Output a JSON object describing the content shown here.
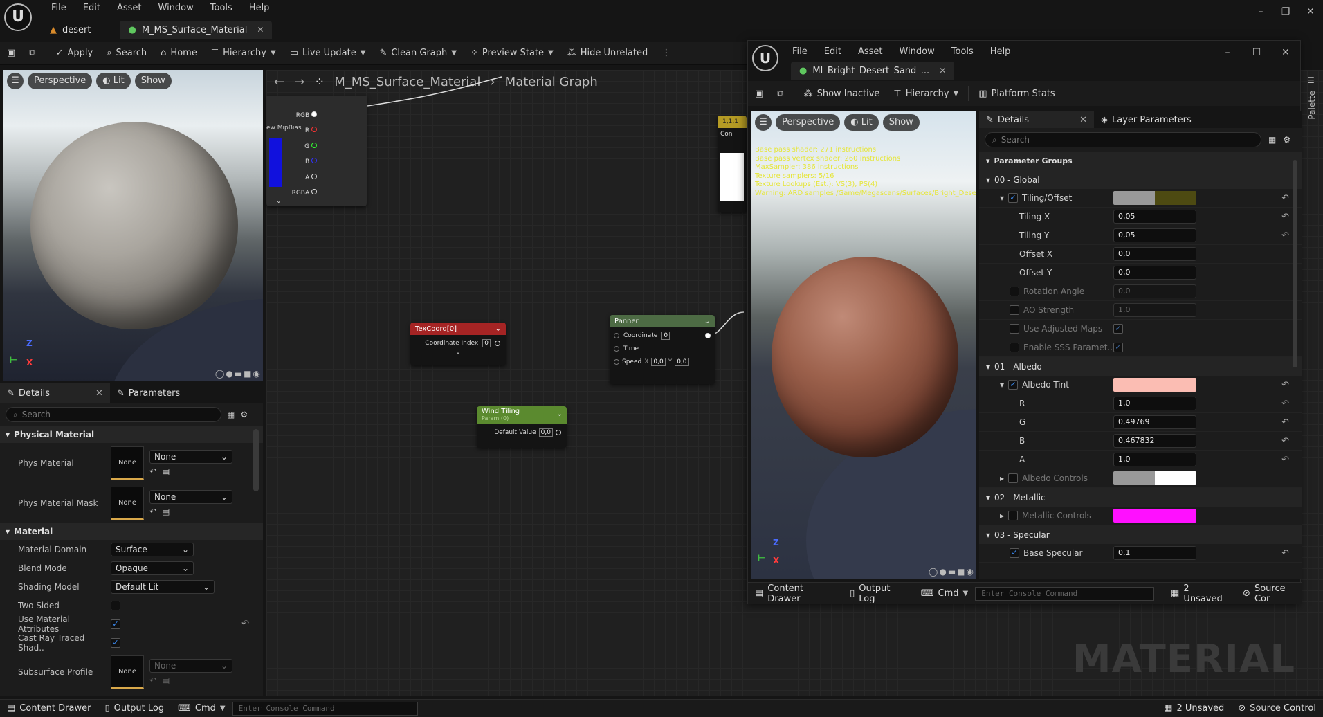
{
  "menu": [
    "File",
    "Edit",
    "Asset",
    "Window",
    "Tools",
    "Help"
  ],
  "doc_tabs": [
    {
      "label": "desert"
    },
    {
      "label": "M_MS_Surface_Material"
    }
  ],
  "toolbar": {
    "apply": "Apply",
    "search": "Search",
    "home": "Home",
    "hierarchy": "Hierarchy",
    "live_update": "Live Update",
    "clean_graph": "Clean Graph",
    "preview_state": "Preview State",
    "hide_unrelated": "Hide Unrelated"
  },
  "left_viewport": {
    "perspective": "Perspective",
    "lit": "Lit",
    "show": "Show"
  },
  "left_details": {
    "tab_details": "Details",
    "tab_parameters": "Parameters",
    "search_placeholder": "Search",
    "physical_material": "Physical Material",
    "phys_material": "Phys Material",
    "phys_material_mask": "Phys Material Mask",
    "none": "None",
    "material_section": "Material",
    "props": [
      {
        "label": "Material Domain",
        "value": "Surface"
      },
      {
        "label": "Blend Mode",
        "value": "Opaque"
      },
      {
        "label": "Shading Model",
        "value": "Default Lit"
      }
    ],
    "two_sided": "Two Sided",
    "use_material_attributes": "Use Material Attributes",
    "cast_ray_traced": "Cast Ray Traced Shad..",
    "subsurface_profile": "Subsurface Profile"
  },
  "graph": {
    "breadcrumb_material": "M_MS_Surface_Material",
    "breadcrumb_graph": "Material Graph",
    "tex_pins": [
      "RGB",
      "R",
      "G",
      "B",
      "A",
      "RGBA"
    ],
    "tex_mip": "ew MipBias",
    "texcoord": {
      "title": "TexCoord[0]",
      "label": "Coordinate Index",
      "value": "0"
    },
    "panner": {
      "title": "Panner",
      "coordinate": "Coordinate",
      "coord_val": "0",
      "time": "Time",
      "speed": "Speed",
      "speed_x": "0,0",
      "speed_y": "0,0",
      "x": "X",
      "y": "Y"
    },
    "wind": {
      "title": "Wind Tiling",
      "subtitle": "Param (0)",
      "label": "Default Value",
      "value": "0,0"
    },
    "const_node": "1,1,1",
    "const_sub": "Con",
    "watermark": "MATERIAL"
  },
  "win2": {
    "menu": [
      "File",
      "Edit",
      "Asset",
      "Window",
      "Tools",
      "Help"
    ],
    "tab": "MI_Bright_Desert_Sand_...",
    "show_inactive": "Show Inactive",
    "hierarchy": "Hierarchy",
    "platform_stats": "Platform Stats",
    "vp_perspective": "Perspective",
    "vp_lit": "Lit",
    "vp_show": "Show",
    "stats": [
      "Base pass shader: 271 instructions",
      "Base pass vertex shader: 260 instructions",
      "MaxSampler: 386 instructions",
      "Texture samplers: 5/16",
      "Texture Lookups (Est.): VS(3), PS(4)",
      "Warning: ARD samples /Game/Megascans/Surfaces/Bright_Dese"
    ],
    "details_tab": "Details",
    "layer_tab": "Layer Parameters",
    "search_placeholder": "Search",
    "parameter_groups": "Parameter Groups",
    "g00": "00 - Global",
    "tiling_offset": "Tiling/Offset",
    "tiling_x": "Tiling X",
    "tiling_x_val": "0,05",
    "tiling_y": "Tiling Y",
    "tiling_y_val": "0,05",
    "offset_x": "Offset X",
    "offset_x_val": "0,0",
    "offset_y": "Offset Y",
    "offset_y_val": "0,0",
    "rotation": "Rotation Angle",
    "rotation_val": "0,0",
    "ao": "AO Strength",
    "ao_val": "1,0",
    "use_adjusted": "Use Adjusted Maps",
    "enable_sss": "Enable SSS Paramet...",
    "g01": "01 - Albedo",
    "albedo_tint": "Albedo Tint",
    "r": "R",
    "r_val": "1,0",
    "g": "G",
    "g_val": "0,49769",
    "b": "B",
    "b_val": "0,467832",
    "a": "A",
    "a_val": "1,0",
    "albedo_controls": "Albedo Controls",
    "g02": "02 - Metallic",
    "metallic_controls": "Metallic Controls",
    "g03": "03 - Specular",
    "base_specular": "Base Specular",
    "base_specular_val": "0,1",
    "colors": {
      "albedo_tint": "#fbbdb3",
      "metallic": "#ff10ff",
      "tiling": "#4d4a12"
    }
  },
  "status": {
    "content_drawer": "Content Drawer",
    "output_log": "Output Log",
    "cmd": "Cmd",
    "console_placeholder": "Enter Console Command",
    "unsaved": "2 Unsaved",
    "source_control": "Source Control",
    "source_control_short": "Source Cor"
  },
  "palette": "Palette"
}
